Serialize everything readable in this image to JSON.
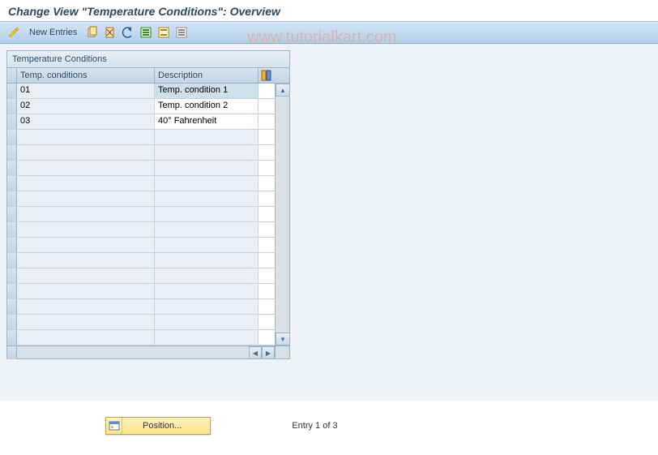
{
  "header": {
    "title": "Change View \"Temperature Conditions\": Overview"
  },
  "toolbar": {
    "new_entries": "New Entries"
  },
  "watermark": "www.tutorialkart.com",
  "table": {
    "caption": "Temperature Conditions",
    "columns": {
      "code": "Temp. conditions",
      "desc": "Description"
    },
    "rows": [
      {
        "code": "01",
        "desc": "Temp. condition 1",
        "selected": true
      },
      {
        "code": "02",
        "desc": "Temp. condition 2",
        "selected": false
      },
      {
        "code": "03",
        "desc": "40° Fahrenheit",
        "selected": false
      }
    ],
    "empty_row_count": 14
  },
  "footer": {
    "position_button": "Position...",
    "entry_text": "Entry 1 of 3"
  }
}
